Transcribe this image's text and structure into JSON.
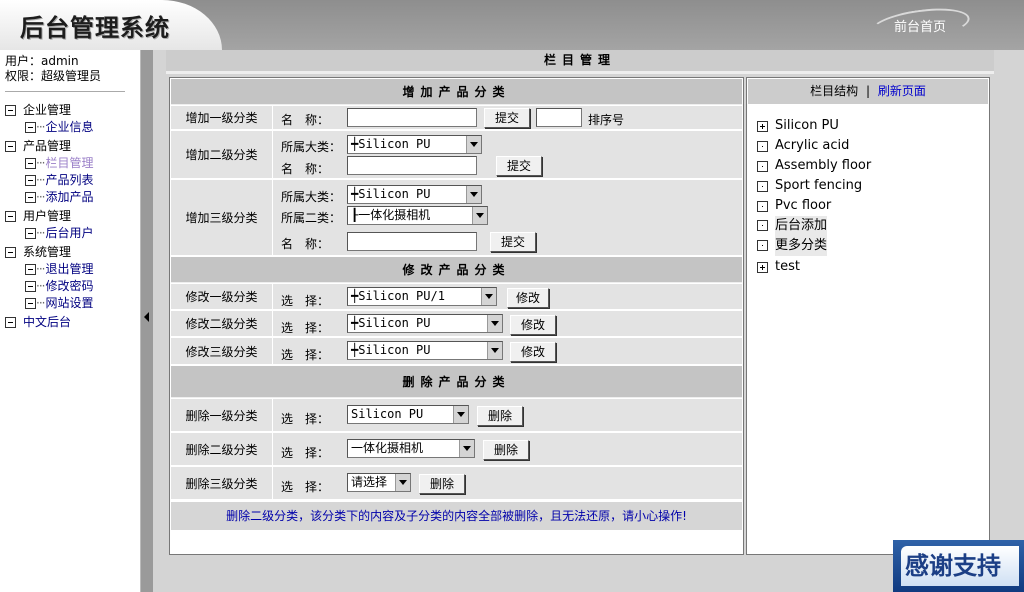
{
  "header": {
    "title": "后台管理系统",
    "home_link": "前台首页"
  },
  "user": {
    "name_line": "用户：admin",
    "role_line": "权限：超级管理员"
  },
  "menu": [
    {
      "label": "企业管理",
      "children": [
        "企业信息"
      ]
    },
    {
      "label": "产品管理",
      "children": [
        "栏目管理",
        "产品列表",
        "添加产品"
      ]
    },
    {
      "label": "用户管理",
      "children": [
        "后台用户"
      ]
    },
    {
      "label": "系统管理",
      "children": [
        "退出管理",
        "修改密码",
        "网站设置"
      ]
    },
    {
      "label": "中文后台",
      "children": []
    }
  ],
  "page_title": "栏目管理",
  "add": {
    "heading": "增加产品分类",
    "level1": {
      "label": "增加一级分类",
      "name_label": "名　称：",
      "name_value": "",
      "submit": "提交",
      "order_value": "",
      "order_label": "排序号"
    },
    "level2": {
      "label": "增加二级分类",
      "parent_label": "所属大类：",
      "parent_value": "┿Silicon PU",
      "name_label": "名　称：",
      "name_value": "",
      "submit": "提交"
    },
    "level3": {
      "label": "增加三级分类",
      "parent_label": "所属大类：",
      "parent_value": "┿Silicon PU",
      "sub_label": "所属二类：",
      "sub_value": "┠一体化摄相机",
      "name_label": "名　称：",
      "name_value": "",
      "submit": "提交"
    }
  },
  "modify": {
    "heading": "修改产品分类",
    "rows": [
      {
        "label": "修改一级分类",
        "select_label": "选　择：",
        "value": "┿Silicon PU/1",
        "button": "修改"
      },
      {
        "label": "修改二级分类",
        "select_label": "选　择：",
        "value": "┿Silicon PU",
        "button": "修改"
      },
      {
        "label": "修改三级分类",
        "select_label": "选　择：",
        "value": "┿Silicon PU",
        "button": "修改"
      }
    ]
  },
  "delete": {
    "heading": "删除产品分类",
    "rows": [
      {
        "label": "删除一级分类",
        "select_label": "选　择：",
        "value": "Silicon PU",
        "button": "删除"
      },
      {
        "label": "删除二级分类",
        "select_label": "选　择：",
        "value": "一体化摄相机",
        "button": "删除"
      },
      {
        "label": "删除三级分类",
        "select_label": "选　择：",
        "value": "请选择",
        "button": "删除"
      }
    ],
    "warning": "删除二级分类，该分类下的内容及子分类的内容全部被删除，且无法还原，请小心操作!"
  },
  "structure": {
    "heading": "栏目结构",
    "separator": "|",
    "refresh": "刷新页面",
    "items": [
      {
        "label": "Silicon PU",
        "icon": "plus-box-icon"
      },
      {
        "label": "Acrylic acid",
        "icon": "dot-box-icon"
      },
      {
        "label": "Assembly floor",
        "icon": "dot-box-icon"
      },
      {
        "label": "Sport fencing",
        "icon": "dot-box-icon"
      },
      {
        "label": "Pvc floor",
        "icon": "dot-box-icon"
      },
      {
        "label": "后台添加",
        "icon": "dot-box-icon"
      },
      {
        "label": "更多分类",
        "icon": "dot-box-icon"
      },
      {
        "label": "test",
        "icon": "plus-box-icon"
      }
    ]
  },
  "badge": "感谢支持"
}
